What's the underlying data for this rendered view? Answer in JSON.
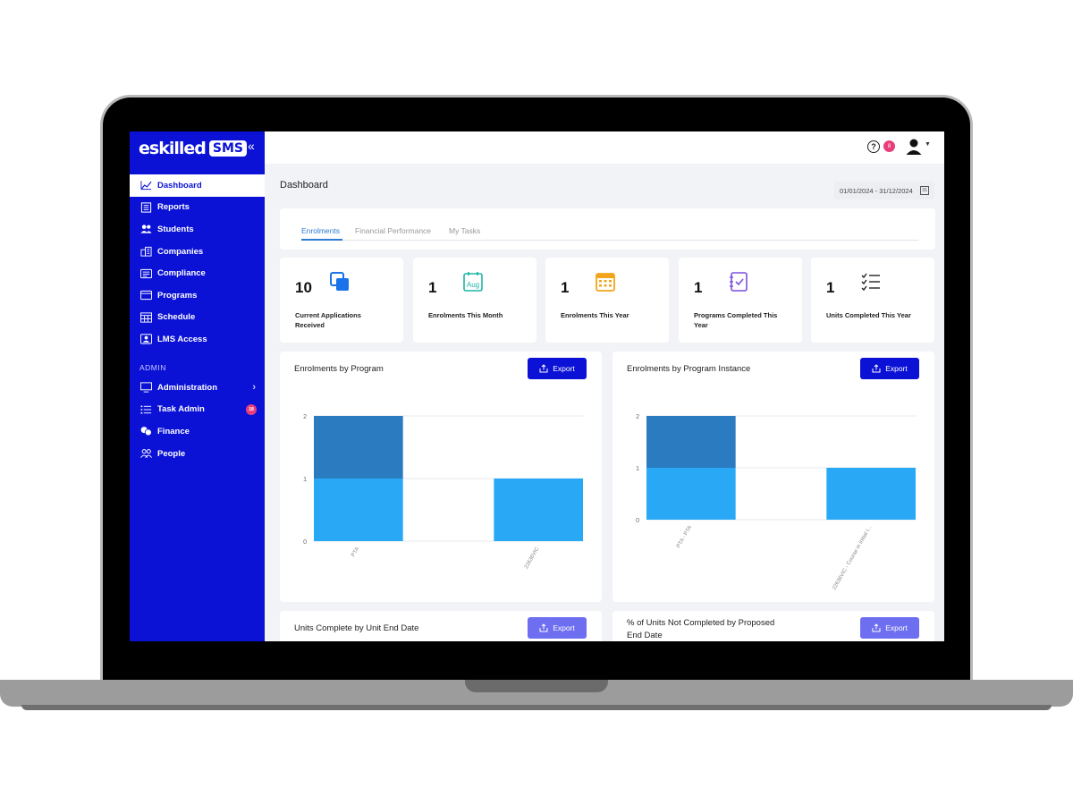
{
  "brand": {
    "logo_text": "eskilled",
    "logo_badge": "SMS",
    "collapse": "«"
  },
  "sidebar": {
    "items": [
      {
        "label": "Dashboard",
        "icon": "chart-line-icon",
        "active": true
      },
      {
        "label": "Reports",
        "icon": "report-icon"
      },
      {
        "label": "Students",
        "icon": "students-icon"
      },
      {
        "label": "Companies",
        "icon": "building-icon"
      },
      {
        "label": "Compliance",
        "icon": "compliance-icon"
      },
      {
        "label": "Programs",
        "icon": "programs-icon"
      },
      {
        "label": "Schedule",
        "icon": "schedule-icon"
      },
      {
        "label": "LMS Access",
        "icon": "lms-icon"
      }
    ],
    "admin_heading": "ADMIN",
    "admin_items": [
      {
        "label": "Administration",
        "icon": "monitor-icon",
        "chevron": "›"
      },
      {
        "label": "Task Admin",
        "icon": "list-icon",
        "badge": "18"
      },
      {
        "label": "Finance",
        "icon": "coins-icon"
      },
      {
        "label": "People",
        "icon": "people-icon"
      }
    ]
  },
  "topbar": {
    "help": "?",
    "notifications": "8"
  },
  "page": {
    "title": "Dashboard",
    "date_range": "01/01/2024 - 31/12/2024",
    "calendar_label": "31"
  },
  "tabs": [
    {
      "label": "Enrolments",
      "active": true
    },
    {
      "label": "Financial Performance"
    },
    {
      "label": "My Tasks"
    }
  ],
  "stats": [
    {
      "value": "10",
      "label": "Current Applications Received",
      "icon": "copy-squares-icon",
      "color": "#1a73e8"
    },
    {
      "value": "1",
      "label": "Enrolments This Month",
      "icon": "calendar-month-icon",
      "color": "#1fb5a6"
    },
    {
      "value": "1",
      "label": "Enrolments This Year",
      "icon": "calendar-year-icon",
      "color": "#f2a51c"
    },
    {
      "value": "1",
      "label": "Programs Completed This Year",
      "icon": "checklist-notebook-icon",
      "color": "#7b4fe0"
    },
    {
      "value": "1",
      "label": "Units Completed This Year",
      "icon": "task-list-icon",
      "color": "#222222"
    }
  ],
  "stat_icon_text": {
    "month": "Aug"
  },
  "export_label": "Export",
  "charts": {
    "program_title": "Enrolments by Program",
    "instance_title": "Enrolments by Program Instance",
    "units_title": "Units Complete by Unit End Date",
    "not_completed_title_line1": "% of Units Not Completed by Proposed",
    "not_completed_title_line2": "End Date"
  },
  "chart_data": [
    {
      "type": "bar",
      "title": "Enrolments by Program",
      "categories": [
        "PTA",
        "",
        "22636VIC"
      ],
      "series": [
        {
          "values": [
            1,
            0,
            1
          ],
          "color": "#29a9f5"
        },
        {
          "values": [
            1,
            0,
            0
          ],
          "color": "#2a7bc0"
        }
      ],
      "stacked": true,
      "ylim": [
        0,
        2
      ],
      "yticks": [
        "0",
        "1",
        "2"
      ]
    },
    {
      "type": "bar",
      "title": "Enrolments by Program Instance",
      "categories": [
        "PTA - PTA",
        "",
        "22636VIC - Course in Initial I..."
      ],
      "series": [
        {
          "values": [
            1,
            0,
            1
          ],
          "color": "#29a9f5"
        },
        {
          "values": [
            1,
            0,
            0
          ],
          "color": "#2a7bc0"
        }
      ],
      "stacked": true,
      "ylim": [
        0,
        2
      ],
      "yticks": [
        "0",
        "1",
        "2"
      ]
    }
  ]
}
